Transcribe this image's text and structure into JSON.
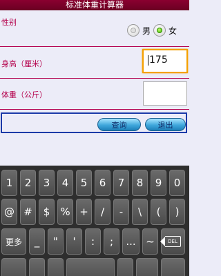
{
  "app": {
    "title": "标准体重计算器"
  },
  "form": {
    "gender_label": "性别",
    "gender_options": [
      {
        "label": "男",
        "checked": false
      },
      {
        "label": "女",
        "checked": true
      }
    ],
    "height_label": "身高（厘米）",
    "height_value": "175",
    "weight_label": "体重（公斤）",
    "weight_value": ""
  },
  "buttons": {
    "query": "查询",
    "exit": "退出"
  },
  "keyboard": {
    "row1": [
      "1",
      "2",
      "3",
      "4",
      "5",
      "6",
      "7",
      "8",
      "9",
      "0"
    ],
    "row2": [
      "@",
      "#",
      "$",
      "%",
      "+",
      "/",
      "-",
      "\\",
      "(",
      ")"
    ],
    "row3": [
      "更多",
      "_",
      "\"",
      "'",
      ":",
      ";",
      "...",
      "~"
    ],
    "delete_key": "DEL"
  },
  "colors": {
    "label": "#b4004b",
    "title_bar": "#7a0028",
    "accent_focus": "#f5a000",
    "radio_checked": "#39b400",
    "button": "#3fa7dc"
  }
}
